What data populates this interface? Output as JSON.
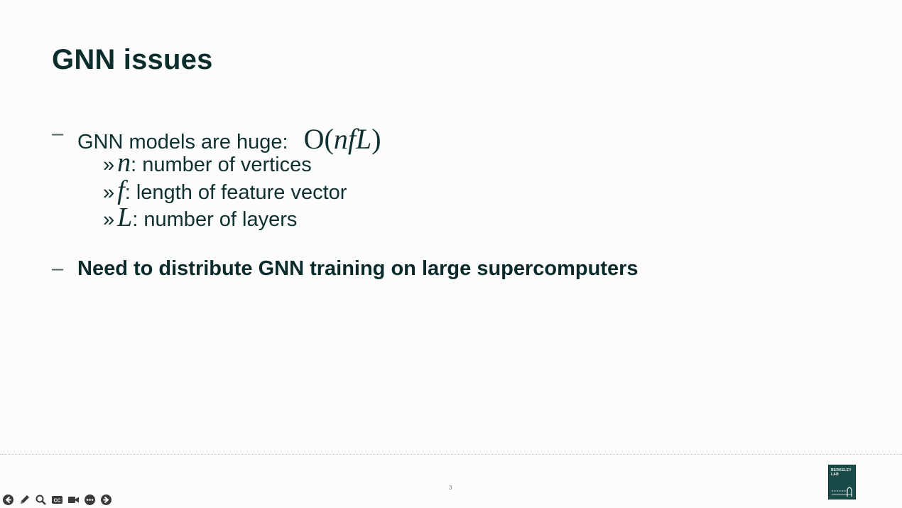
{
  "slide": {
    "title": "GNN issues",
    "bullets": [
      {
        "dash": "–",
        "text": "GNN models are huge:",
        "formula": {
          "open": "O(",
          "vars": "nfL",
          "close": ")"
        },
        "sub_items": [
          {
            "chevron": "»",
            "symbol": "n",
            "text": ": number of vertices"
          },
          {
            "chevron": "»",
            "symbol": "f",
            "text": ": length of feature vector"
          },
          {
            "chevron": "»",
            "symbol": "L",
            "text": ": number of layers"
          }
        ]
      },
      {
        "dash": "–",
        "text": "Need to distribute GNN training on large supercomputers"
      }
    ],
    "page_number": "3",
    "logo_text": [
      "BERKELEY",
      "LAB"
    ]
  },
  "toolbar": {
    "icons": [
      "back-arrow-icon",
      "pen-icon",
      "zoom-icon",
      "captions-icon",
      "video-icon",
      "more-icon",
      "forward-arrow-icon"
    ]
  },
  "colors": {
    "text": "#0b2e2c",
    "background": "#fbfcfb",
    "logo": "#1b4b49",
    "toolbar_icon": "#3a3a3a"
  }
}
